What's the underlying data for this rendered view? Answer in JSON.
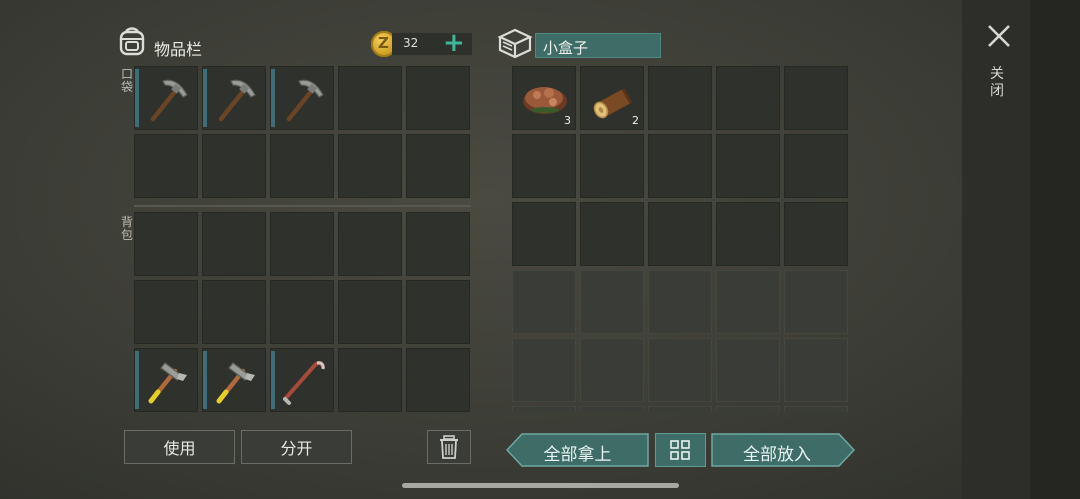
{
  "inventory": {
    "title": "物品栏",
    "pocket_label": "口袋",
    "backpack_label": "背包"
  },
  "currency": {
    "amount": "32",
    "add_symbol": "+"
  },
  "container": {
    "name": "小盒子"
  },
  "pocket_slots": [
    {
      "item": "pickaxe",
      "qty": ""
    },
    {
      "item": "pickaxe",
      "qty": ""
    },
    {
      "item": "pickaxe",
      "qty": ""
    },
    {
      "item": "",
      "qty": ""
    },
    {
      "item": "",
      "qty": ""
    },
    {
      "item": "",
      "qty": ""
    },
    {
      "item": "",
      "qty": ""
    },
    {
      "item": "",
      "qty": ""
    },
    {
      "item": "",
      "qty": ""
    },
    {
      "item": "",
      "qty": ""
    }
  ],
  "backpack_slots": [
    {
      "item": "",
      "qty": ""
    },
    {
      "item": "",
      "qty": ""
    },
    {
      "item": "",
      "qty": ""
    },
    {
      "item": "",
      "qty": ""
    },
    {
      "item": "",
      "qty": ""
    },
    {
      "item": "",
      "qty": ""
    },
    {
      "item": "",
      "qty": ""
    },
    {
      "item": "",
      "qty": ""
    },
    {
      "item": "",
      "qty": ""
    },
    {
      "item": "",
      "qty": ""
    },
    {
      "item": "hammer",
      "qty": ""
    },
    {
      "item": "hammer",
      "qty": ""
    },
    {
      "item": "crowbar",
      "qty": ""
    },
    {
      "item": "",
      "qty": ""
    },
    {
      "item": "",
      "qty": ""
    }
  ],
  "container_slots": [
    {
      "item": "meat",
      "qty": "3"
    },
    {
      "item": "log",
      "qty": "2"
    },
    {
      "item": "",
      "qty": ""
    },
    {
      "item": "",
      "qty": ""
    },
    {
      "item": "",
      "qty": ""
    },
    {
      "item": "",
      "qty": ""
    },
    {
      "item": "",
      "qty": ""
    },
    {
      "item": "",
      "qty": ""
    },
    {
      "item": "",
      "qty": ""
    },
    {
      "item": "",
      "qty": ""
    },
    {
      "item": "",
      "qty": ""
    },
    {
      "item": "",
      "qty": ""
    },
    {
      "item": "",
      "qty": ""
    },
    {
      "item": "",
      "qty": ""
    },
    {
      "item": "",
      "qty": ""
    }
  ],
  "container_locked_rows": 3,
  "buttons": {
    "use": "使用",
    "split": "分开",
    "take_all": "全部拿上",
    "put_all": "全部放入"
  },
  "close": {
    "label": "关闭"
  },
  "colors": {
    "accent": "#3e6c67",
    "durability": "#3c6f78",
    "plus": "#3fb59a"
  }
}
